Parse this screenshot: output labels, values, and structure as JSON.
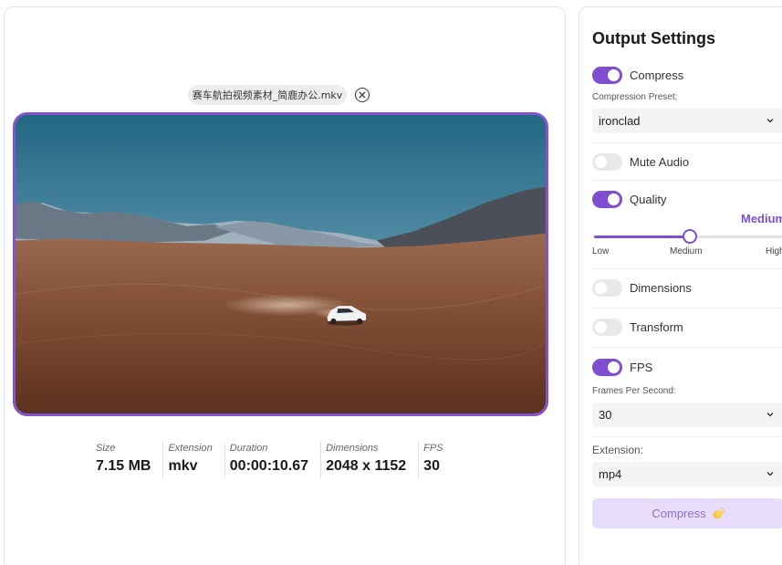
{
  "file": {
    "name": "赛车航拍视频素材_简鹿办公.mkv"
  },
  "video": {
    "icons": {
      "close": "circle-x-icon"
    },
    "scene_colors": {
      "sky_top": "#2a6c86",
      "sky_bottom": "#a7c3cf",
      "ground": "#7b4a30",
      "accent_frame": "#8452c9"
    }
  },
  "meta": [
    {
      "label": "Size",
      "value": "7.15 MB"
    },
    {
      "label": "Extension",
      "value": "mkv"
    },
    {
      "label": "Duration",
      "value": "00:00:10.67"
    },
    {
      "label": "Dimensions",
      "value": "2048 x 1152"
    },
    {
      "label": "FPS",
      "value": "30"
    }
  ],
  "settings": {
    "title": "Output Settings",
    "compress": {
      "label": "Compress",
      "on": true
    },
    "preset": {
      "label": "Compression Preset:",
      "value": "ironclad"
    },
    "mute": {
      "label": "Mute Audio",
      "on": false
    },
    "quality": {
      "label": "Quality",
      "on": true,
      "current": "Medium",
      "level": 0.5,
      "ticks": [
        "Low",
        "Medium",
        "High"
      ]
    },
    "dimensions": {
      "label": "Dimensions",
      "on": false
    },
    "transform": {
      "label": "Transform",
      "on": false
    },
    "fps": {
      "label": "FPS",
      "on": true
    },
    "fps_field": {
      "label": "Frames Per Second:",
      "value": "30"
    },
    "extension": {
      "label": "Extension:",
      "value": "mp4"
    },
    "button": {
      "label": "Compress",
      "icon": "clapping-hands-icon"
    },
    "accent_color": "#7e4fd1"
  }
}
